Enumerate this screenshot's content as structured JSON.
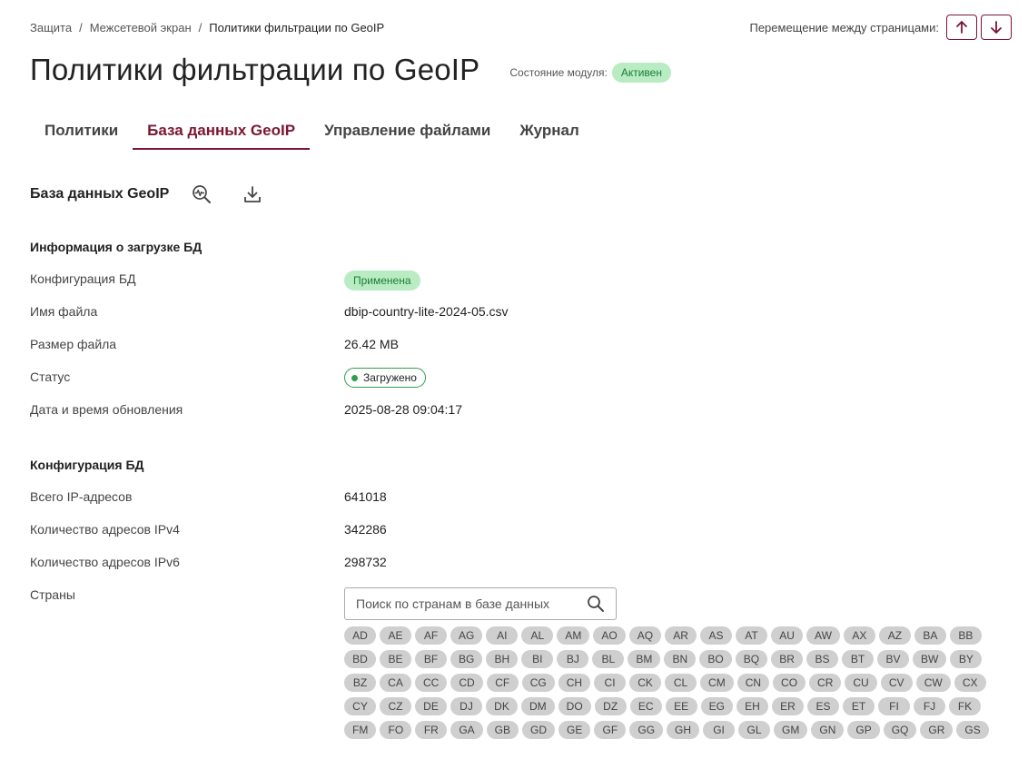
{
  "breadcrumb": [
    "Защита",
    "Межсетевой экран",
    "Политики фильтрации по GeoIP"
  ],
  "pager": {
    "label": "Перемещение между страницами:",
    "up_icon": "arrow-up-icon",
    "down_icon": "arrow-down-icon"
  },
  "page": {
    "title": "Политики фильтрации по GeoIP",
    "module_label": "Состояние модуля:",
    "module_status": "Активен"
  },
  "tabs": [
    {
      "label": "Политики",
      "active": false
    },
    {
      "label": "База данных GeoIP",
      "active": true
    },
    {
      "label": "Управление файлами",
      "active": false
    },
    {
      "label": "Журнал",
      "active": false
    }
  ],
  "section": {
    "title": "База данных GeoIP",
    "icons": [
      "search-activity-icon",
      "download-icon"
    ]
  },
  "load_info": {
    "title": "Информация о загрузке БД",
    "rows": [
      {
        "label": "Конфигурация БД",
        "value": "Применена"
      },
      {
        "label": "Имя файла",
        "value": "dbip-country-lite-2024-05.csv"
      },
      {
        "label": "Размер файла",
        "value": "26.42 MB"
      },
      {
        "label": "Статус",
        "value": "Загружено"
      },
      {
        "label": "Дата и время обновления",
        "value": "2025-08-28 09:04:17"
      }
    ]
  },
  "db_config": {
    "title": "Конфигурация БД",
    "rows": [
      {
        "label": "Всего IP-адресов",
        "value": "641018"
      },
      {
        "label": "Количество адресов IPv4",
        "value": "342286"
      },
      {
        "label": "Количество адресов IPv6",
        "value": "298732"
      },
      {
        "label": "Страны",
        "value": ""
      }
    ]
  },
  "search": {
    "placeholder": "Поиск по странам в базе данных",
    "value": ""
  },
  "countries": [
    "AD",
    "AE",
    "AF",
    "AG",
    "AI",
    "AL",
    "AM",
    "AO",
    "AQ",
    "AR",
    "AS",
    "AT",
    "AU",
    "AW",
    "AX",
    "AZ",
    "BA",
    "BB",
    "BD",
    "BE",
    "BF",
    "BG",
    "BH",
    "BI",
    "BJ",
    "BL",
    "BM",
    "BN",
    "BO",
    "BQ",
    "BR",
    "BS",
    "BT",
    "BV",
    "BW",
    "BY",
    "BZ",
    "CA",
    "CC",
    "CD",
    "CF",
    "CG",
    "CH",
    "CI",
    "CK",
    "CL",
    "CM",
    "CN",
    "CO",
    "CR",
    "CU",
    "CV",
    "CW",
    "CX",
    "CY",
    "CZ",
    "DE",
    "DJ",
    "DK",
    "DM",
    "DO",
    "DZ",
    "EC",
    "EE",
    "EG",
    "EH",
    "ER",
    "ES",
    "ET",
    "FI",
    "FJ",
    "FK",
    "FM",
    "FO",
    "FR",
    "GA",
    "GB",
    "GD",
    "GE",
    "GF",
    "GG",
    "GH",
    "GI",
    "GL",
    "GM",
    "GN",
    "GP",
    "GQ",
    "GR",
    "GS"
  ],
  "colors": {
    "accent": "#7a1633",
    "success_bg": "#b9ecc3",
    "success_text": "#1a7d35",
    "chip_bg": "#cfcfcf"
  }
}
